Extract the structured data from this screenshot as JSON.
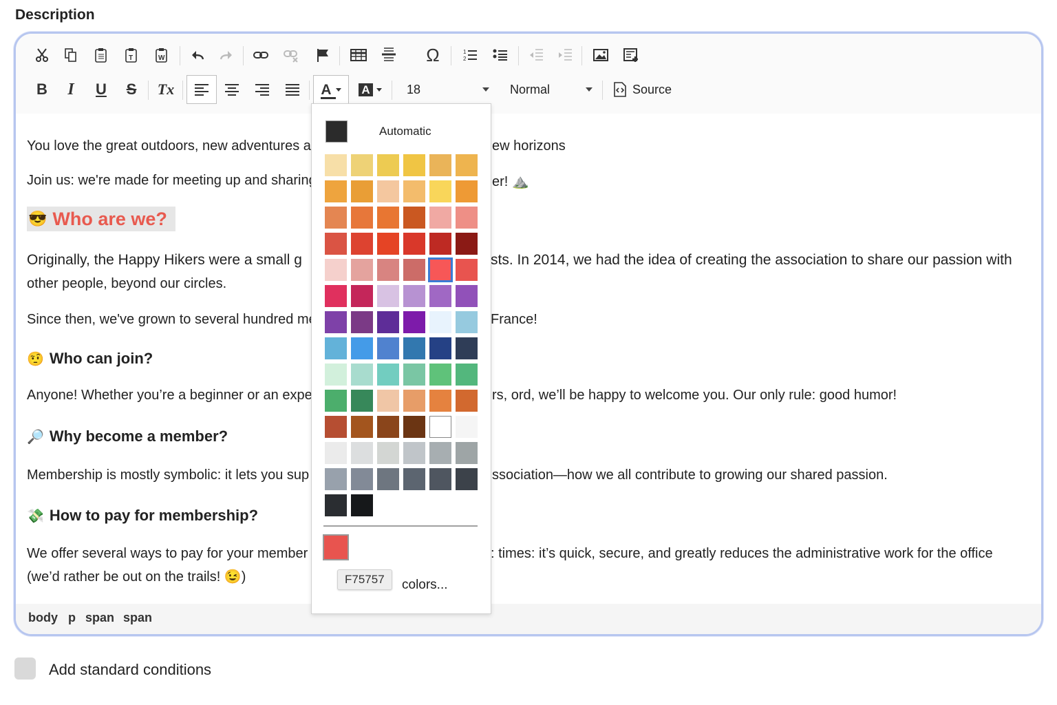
{
  "field_label": "Description",
  "toolbar": {
    "row1_icons": [
      "cut-icon",
      "copy-icon",
      "paste-icon",
      "paste-text-icon",
      "paste-word-icon",
      "undo-icon",
      "redo-icon",
      "link-icon",
      "unlink-icon",
      "anchor-flag-icon",
      "table-icon",
      "horizontal-rule-icon",
      "special-char-icon",
      "numbered-list-icon",
      "bulleted-list-icon",
      "decrease-indent-icon",
      "increase-indent-icon",
      "image-icon",
      "insert-template-icon"
    ],
    "bold": "B",
    "italic": "I",
    "underline": "U",
    "strike": "S",
    "remove_format": "Tx",
    "text_color_glyph": "A",
    "bg_color_glyph": "A",
    "font_size": "18",
    "format": "Normal",
    "source_label": "Source"
  },
  "content": {
    "line1_left": "You love the great outdoors, new adventures ar",
    "line1_right": "ew horizons",
    "line2_left": "Join us: we're made for meeting up and sharing",
    "line2_right": "er! ⛰️",
    "h1_emoji": "😎",
    "h1": "Who are we?",
    "para1_line1_left": "Originally, the Happy Hikers were a small g",
    "para1_line1_right": "sts. In 2014, we had the idea of creating the association to share our passion with",
    "para1_line2": "other people, beyond our circles.",
    "para2_left": "Since then, we've grown to several hundred mer",
    "para2_right": "France!",
    "h2_emoji": "🤨",
    "h2": "Who can join?",
    "para3_left": "Anyone! Whether you’re a beginner or an experie",
    "para3_right": "rs, ord, we’ll be happy to welcome you. Our only rule: good humor!",
    "h3_emoji": "🔎",
    "h3": "Why become a member?",
    "para4_left": "Membership is mostly symbolic: it lets you sup",
    "para4_right": "ssociation—how we all contribute to growing our shared passion.",
    "h4_emoji": "💸",
    "h4": "How to pay for membership?",
    "para5_line1_left": "We offer several ways to pay for your member",
    "para5_line1_right": ": times: it’s quick, secure, and greatly reduces the administrative work for the office",
    "para5_line2": "(we’d rather be out on the trails! 😉)"
  },
  "element_path": [
    "body",
    "p",
    "span",
    "span"
  ],
  "color_panel": {
    "automatic_label": "Automatic",
    "automatic_color": "#2b2b2b",
    "swatches": [
      "#F7DFA8",
      "#EED276",
      "#EDCB52",
      "#F0C544",
      "#EAB459",
      "#EEB44F",
      "#EEA43E",
      "#E99E36",
      "#F4C79F",
      "#F3BC6C",
      "#F9D65A",
      "#EE9A35",
      "#E48652",
      "#E7773A",
      "#E87632",
      "#CA5821",
      "#F0A9A3",
      "#EE8F86",
      "#DA5444",
      "#DD4330",
      "#E54425",
      "#D9382A",
      "#BE2A23",
      "#8B1A15",
      "#F5D0CC",
      "#E4A39E",
      "#D88481",
      "#CC6C68",
      "#F75757",
      "#E8544F",
      "#E0305E",
      "#C4265A",
      "#D8C2E3",
      "#B792D2",
      "#A068C4",
      "#9151B9",
      "#7E41A8",
      "#7B3A86",
      "#5E2D98",
      "#7D1BAA",
      "#E8F3FD",
      "#96CADF",
      "#63B2D9",
      "#449BE8",
      "#5082CF",
      "#3278AF",
      "#254185",
      "#2F3D57",
      "#D2F0DC",
      "#A8DCCE",
      "#72CDC0",
      "#7AC6A4",
      "#5FC27A",
      "#53B77D",
      "#4CAE6C",
      "#37885A",
      "#F0C6A6",
      "#E79D68",
      "#E5823F",
      "#D2692F",
      "#B64E32",
      "#A3551E",
      "#8A451B",
      "#6B3513",
      "#FFFFFF",
      "#F5F5F5",
      "#EBEBEB",
      "#DCDEDF",
      "#D3D6D3",
      "#C0C5C9",
      "#A7AEB1",
      "#9EA5A6",
      "#98A1AC",
      "#828A97",
      "#6E7680",
      "#5C6570",
      "#4F5660",
      "#3C424A",
      "#2A2D31",
      "#16181A"
    ],
    "selected_index": 28,
    "current_color": "#E8544F",
    "current_hex": "F75757",
    "more_colors_label": "colors..."
  },
  "checkbox_label": "Add standard conditions"
}
